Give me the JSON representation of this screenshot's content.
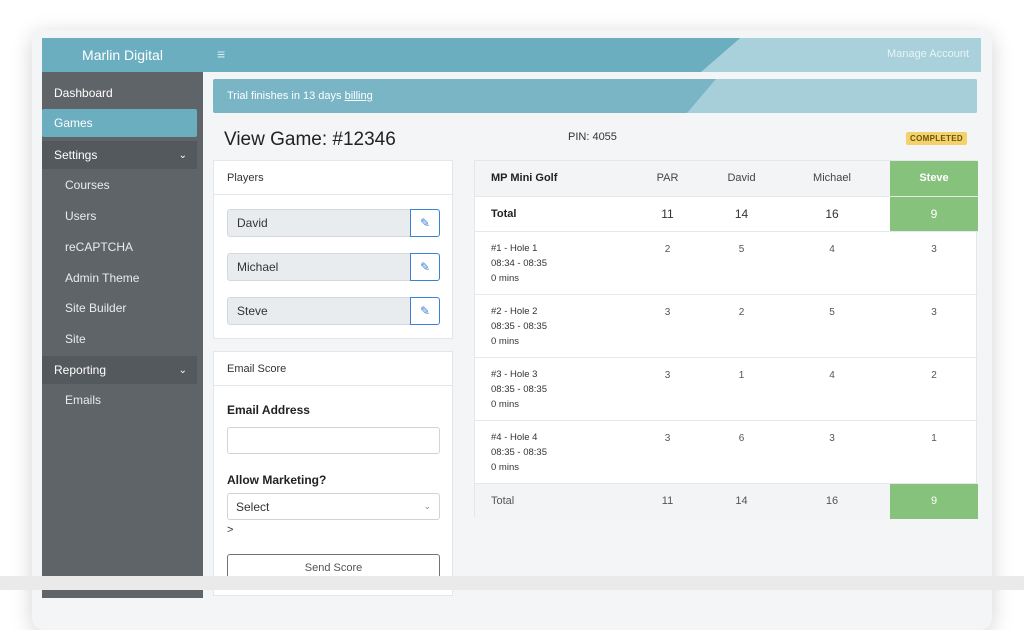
{
  "app": {
    "brand": "Marlin Digital",
    "manage_account": "Manage Account"
  },
  "sidebar": {
    "items": [
      {
        "label": "Dashboard"
      },
      {
        "label": "Games"
      },
      {
        "label": "Settings"
      },
      {
        "label": "Courses"
      },
      {
        "label": "Users"
      },
      {
        "label": "reCAPTCHA"
      },
      {
        "label": "Admin Theme"
      },
      {
        "label": "Site Builder"
      },
      {
        "label": "Site"
      },
      {
        "label": "Reporting"
      },
      {
        "label": "Emails"
      }
    ]
  },
  "trial": {
    "text": "Trial finishes in 13 days",
    "link": "billing"
  },
  "game": {
    "title": "View Game: #12346",
    "pin": "PIN: 4055",
    "status": "COMPLETED"
  },
  "players_card": {
    "header": "Players",
    "players": [
      "David",
      "Michael",
      "Steve"
    ]
  },
  "email_card": {
    "header": "Email Score",
    "email_label": "Email Address",
    "email_value": "",
    "marketing_label": "Allow Marketing?",
    "marketing_selected": "Select",
    "stray_text": ">",
    "send_button": "Send Score"
  },
  "scorecard": {
    "course": "MP Mini Golf",
    "columns": [
      "PAR",
      "David",
      "Michael",
      "Steve"
    ],
    "total_label": "Total",
    "totals": [
      "11",
      "14",
      "16",
      "9"
    ],
    "holes": [
      {
        "name": "#1 - Hole 1",
        "time": "08:34 - 08:35",
        "duration": "0 mins",
        "scores": [
          "2",
          "5",
          "4",
          "3"
        ]
      },
      {
        "name": "#2 - Hole 2",
        "time": "08:35 - 08:35",
        "duration": "0 mins",
        "scores": [
          "3",
          "2",
          "5",
          "3"
        ]
      },
      {
        "name": "#3 - Hole 3",
        "time": "08:35 - 08:35",
        "duration": "0 mins",
        "scores": [
          "3",
          "1",
          "4",
          "2"
        ]
      },
      {
        "name": "#4 - Hole 4",
        "time": "08:35 - 08:35",
        "duration": "0 mins",
        "scores": [
          "3",
          "6",
          "3",
          "1"
        ]
      }
    ],
    "footer_label": "Total",
    "footer_totals": [
      "11",
      "14",
      "16",
      "9"
    ],
    "winner_color": "#86c27b"
  },
  "colors": {
    "accent": "#6aaec0",
    "sidebar": "#5f6468",
    "badge": "#f4d26b"
  }
}
